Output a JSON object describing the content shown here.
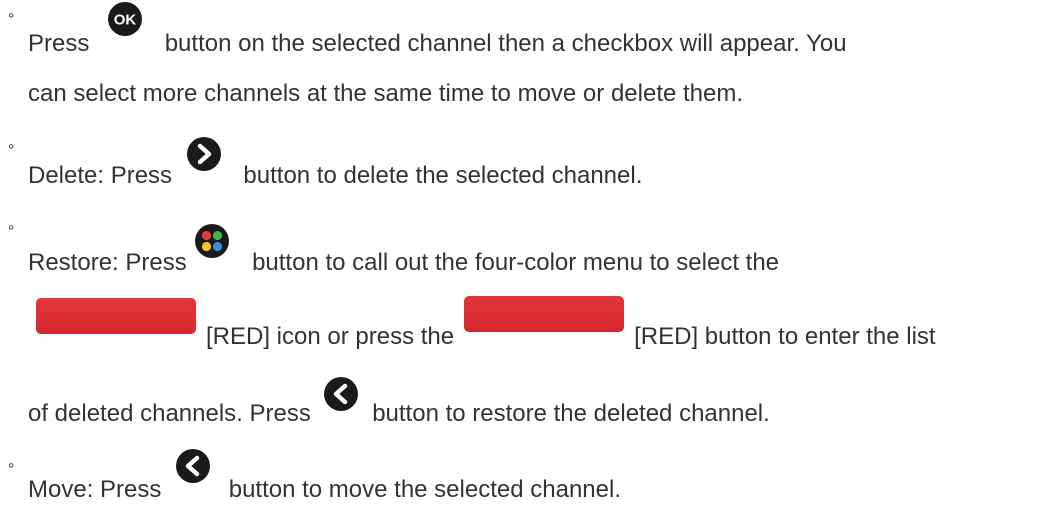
{
  "items": [
    {
      "line1_a": "Press",
      "line1_icon": "ok-button-icon",
      "line1_b": "button on the selected channel then a checkbox will appear. You",
      "line2": "can select more channels at the same time to move or delete them."
    },
    {
      "line1_a": "Delete: Press",
      "line1_icon": "right-arrow-button-icon",
      "line1_b": "button to delete the selected channel."
    },
    {
      "line1_a": "Restore: Press",
      "line1_icon": "four-color-button-icon",
      "line1_b": "button to call out the four-color menu to select the",
      "line2_a": "[RED] icon or press the",
      "line2_b": "[RED] button to enter the list",
      "line3_a": "of deleted channels. Press",
      "line3_icon": "left-arrow-button-icon",
      "line3_b": "button to restore the deleted channel."
    },
    {
      "line1_a": "Move: Press",
      "line1_icon": "left-arrow-button-icon",
      "line1_b": "button to move the selected channel."
    }
  ],
  "bullet_symbol": "°",
  "colors": {
    "text": "#333333",
    "red_key": "#dd2c33",
    "icon": "#1a1a1a"
  }
}
